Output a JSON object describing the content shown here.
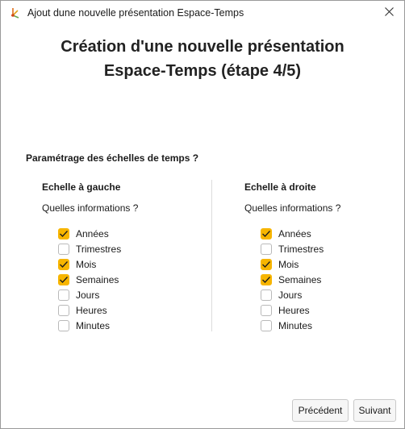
{
  "window": {
    "title": "Ajout dune nouvelle présentation Espace-Temps",
    "close_icon": "close-icon",
    "app_icon": "app-logo-icon"
  },
  "heading": {
    "line1": "Création d'une nouvelle présentation",
    "line2": "Espace-Temps (étape 4/5)"
  },
  "section_label": "Paramétrage des échelles de temps ?",
  "left": {
    "title": "Echelle à gauche",
    "question": "Quelles informations ?",
    "options": [
      {
        "label": "Années",
        "checked": true
      },
      {
        "label": "Trimestres",
        "checked": false
      },
      {
        "label": "Mois",
        "checked": true
      },
      {
        "label": "Semaines",
        "checked": true
      },
      {
        "label": "Jours",
        "checked": false
      },
      {
        "label": "Heures",
        "checked": false
      },
      {
        "label": "Minutes",
        "checked": false
      }
    ]
  },
  "right": {
    "title": "Echelle à droite",
    "question": "Quelles informations ?",
    "options": [
      {
        "label": "Années",
        "checked": true
      },
      {
        "label": "Trimestres",
        "checked": false
      },
      {
        "label": "Mois",
        "checked": true
      },
      {
        "label": "Semaines",
        "checked": true
      },
      {
        "label": "Jours",
        "checked": false
      },
      {
        "label": "Heures",
        "checked": false
      },
      {
        "label": "Minutes",
        "checked": false
      }
    ]
  },
  "buttons": {
    "previous": "Précédent",
    "next": "Suivant"
  },
  "colors": {
    "checkbox_checked": "#f7b500",
    "checkbox_border": "#b9b9b9"
  }
}
